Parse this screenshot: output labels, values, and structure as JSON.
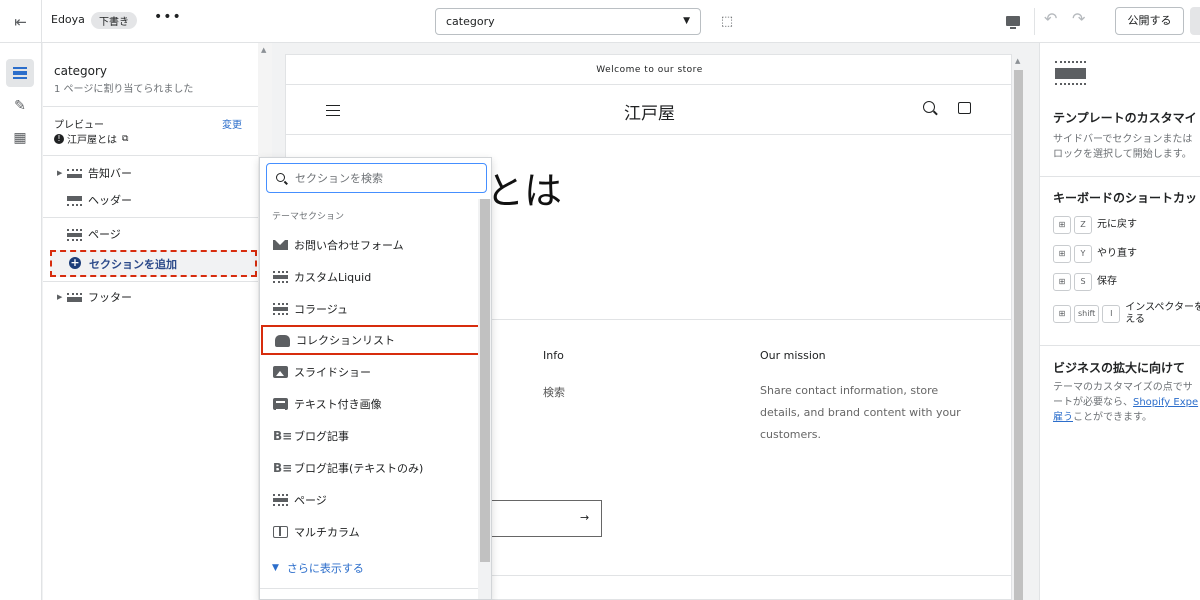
{
  "topbar": {
    "store_name": "Edoya",
    "draft_badge": "下書き",
    "more": "•••",
    "template_select": "category",
    "publish": "公開する"
  },
  "sidebar": {
    "title": "category",
    "subtitle": "1 ページに割り当てられました",
    "preview_label": "プレビュー",
    "change_link": "変更",
    "preview_page": "江戸屋とは",
    "items": [
      {
        "label": "告知バー"
      },
      {
        "label": "ヘッダー"
      },
      {
        "label": "ページ"
      },
      {
        "label": "セクションを追加"
      },
      {
        "label": "フッター"
      }
    ]
  },
  "preview": {
    "announcement": "Welcome to our store",
    "brand": "江戸屋",
    "heading_visible": "とは",
    "footer_info_title": "Info",
    "footer_info_link": "検索",
    "footer_mission_title": "Our mission",
    "footer_mission_text": "Share contact information, store details, and brand content with your customers."
  },
  "popover": {
    "search_placeholder": "セクションを検索",
    "caption": "テーマセクション",
    "items": [
      {
        "label": "お問い合わせフォーム",
        "icon": "envelope-icon"
      },
      {
        "label": "カスタムLiquid",
        "icon": "section-icon"
      },
      {
        "label": "コラージュ",
        "icon": "section-icon"
      },
      {
        "label": "コレクションリスト",
        "icon": "tag-icon",
        "highlighted": true
      },
      {
        "label": "スライドショー",
        "icon": "image-icon"
      },
      {
        "label": "テキスト付き画像",
        "icon": "document-icon"
      },
      {
        "label": "ブログ記事",
        "icon": "blog-icon"
      },
      {
        "label": "ブログ記事(テキストのみ)",
        "icon": "blog-icon"
      },
      {
        "label": "ページ",
        "icon": "section-icon"
      },
      {
        "label": "マルチカラム",
        "icon": "columns-icon"
      }
    ],
    "show_more": "さらに表示する"
  },
  "right_panel": {
    "template_title": "テンプレートのカスタマイ",
    "template_desc_1": "サイドバーでセクションまたは",
    "template_desc_2": "ロックを選択して開始します。",
    "shortcuts_title": "キーボードのショートカッ",
    "shortcuts": [
      {
        "keys": [
          "⊞",
          "Z"
        ],
        "label": "元に戻す"
      },
      {
        "keys": [
          "⊞",
          "Y"
        ],
        "label": "やり直す"
      },
      {
        "keys": [
          "⊞",
          "S"
        ],
        "label": "保存"
      },
      {
        "keys": [
          "⊞",
          "shift",
          "I"
        ],
        "label_1": "インスペクターを",
        "label_2": "える"
      }
    ],
    "grow_title": "ビジネスの拡大に向けて",
    "grow_desc_1": "テーマのカスタマイズの点でサ",
    "grow_desc_2_prefix": "ートが必要なら、",
    "grow_link": "Shopify Expe",
    "grow_desc_3_link": "雇う",
    "grow_desc_3_suffix": "ことができます。"
  },
  "colors": {
    "accent_blue": "#2c6ecb",
    "highlight_red": "#d72c0d",
    "focus_blue": "#458fff"
  }
}
